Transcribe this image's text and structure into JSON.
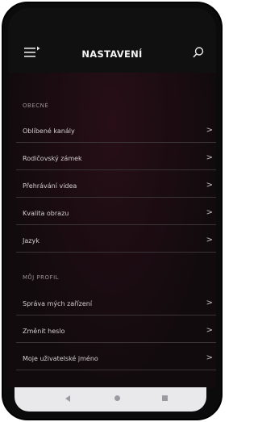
{
  "header": {
    "title": "NASTAVENÍ",
    "menu_icon": "menu-icon",
    "search_icon": "search-icon"
  },
  "sections": [
    {
      "label": "OBECNÉ",
      "items": [
        {
          "label": "Oblíbené kanály",
          "icon": "chevron-right-icon"
        },
        {
          "label": "Rodičovský zámek",
          "icon": "chevron-right-icon"
        },
        {
          "label": "Přehrávání videa",
          "icon": "chevron-right-icon"
        },
        {
          "label": "Kvalita obrazu",
          "icon": "chevron-right-icon"
        },
        {
          "label": "Jazyk",
          "icon": "chevron-right-icon"
        }
      ]
    },
    {
      "label": "MŮJ PROFIL",
      "items": [
        {
          "label": "Správa mých zařízení",
          "icon": "chevron-right-icon"
        },
        {
          "label": "Změnit heslo",
          "icon": "chevron-right-icon"
        },
        {
          "label": "Moje uživatelské jméno",
          "icon": "chevron-right-icon"
        }
      ]
    }
  ],
  "chevron": ">",
  "navbar": {
    "back_icon": "back-icon",
    "home_icon": "home-icon",
    "recent_icon": "recent-apps-icon"
  },
  "colors": {
    "background": "#120b0e",
    "header": "#101010",
    "text": "#d6d0d2",
    "section_label": "#9b8f93",
    "navbar": "#e9e9ec"
  }
}
